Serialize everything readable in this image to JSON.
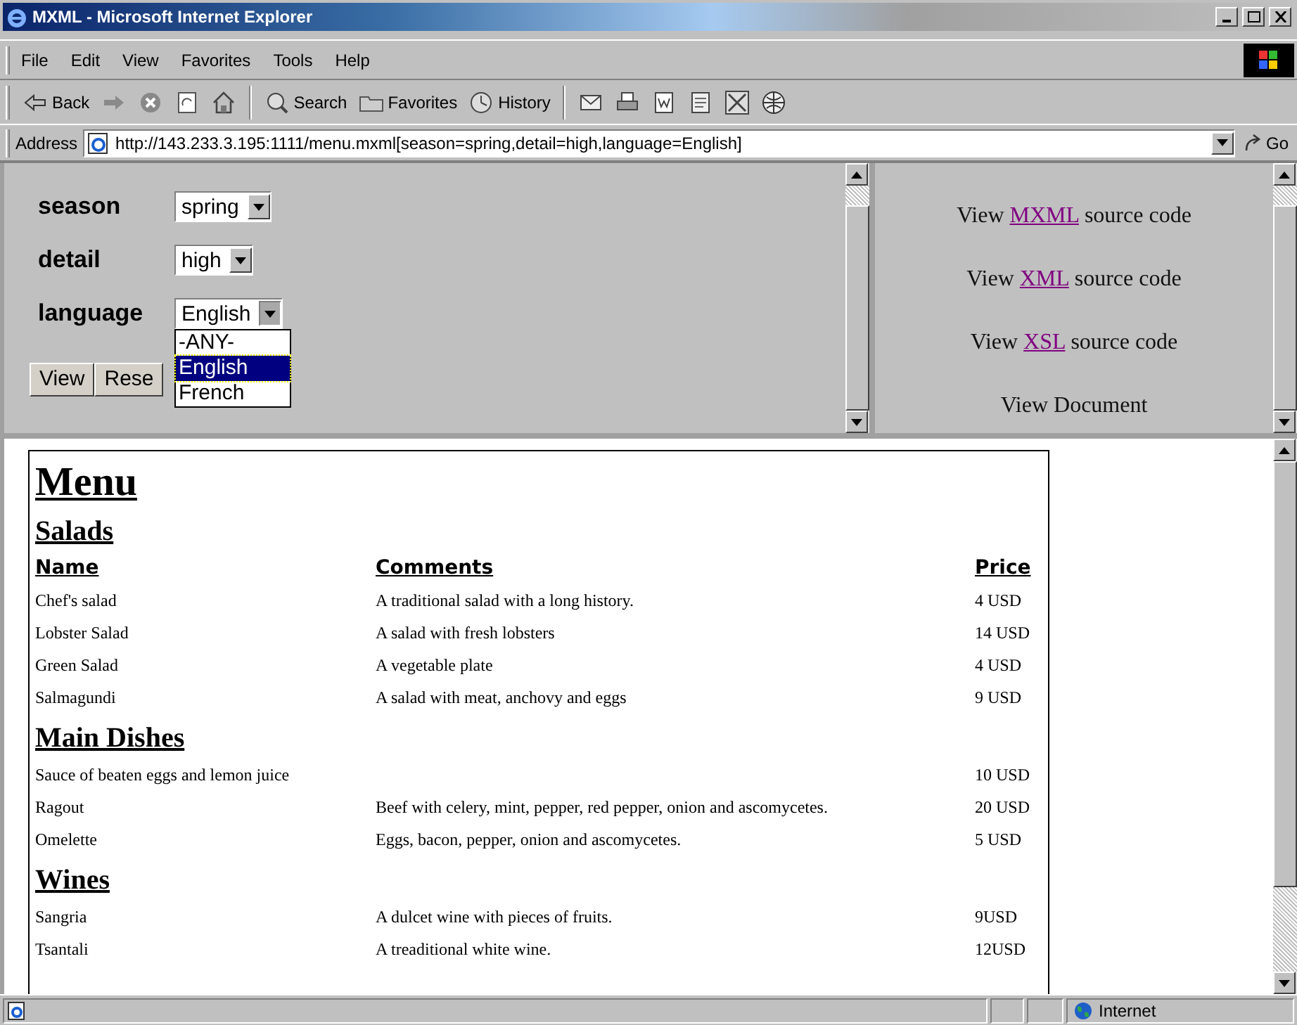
{
  "window": {
    "title": "MXML - Microsoft Internet Explorer"
  },
  "menu": [
    "File",
    "Edit",
    "View",
    "Favorites",
    "Tools",
    "Help"
  ],
  "toolbar": [
    {
      "kind": "back",
      "label": "Back"
    },
    {
      "kind": "forward"
    },
    {
      "kind": "stop"
    },
    {
      "kind": "refresh"
    },
    {
      "kind": "home"
    },
    {
      "kind": "sep"
    },
    {
      "kind": "search",
      "label": "Search"
    },
    {
      "kind": "favorites",
      "label": "Favorites"
    },
    {
      "kind": "history",
      "label": "History"
    },
    {
      "kind": "sep"
    },
    {
      "kind": "mail"
    },
    {
      "kind": "print"
    },
    {
      "kind": "edit"
    },
    {
      "kind": "discuss"
    },
    {
      "kind": "messenger"
    },
    {
      "kind": "globe"
    }
  ],
  "address": {
    "label": "Address",
    "value": "http://143.233.3.195:1111/menu.mxml[season=spring,detail=high,language=English]",
    "go": "Go"
  },
  "form": {
    "fields": [
      {
        "label": "season",
        "value": "spring"
      },
      {
        "label": "detail",
        "value": "high"
      },
      {
        "label": "language",
        "value": "English",
        "expanded": true,
        "options": [
          {
            "label": "-ANY-",
            "selected": false
          },
          {
            "label": "English",
            "selected": true
          },
          {
            "label": "French",
            "selected": false
          }
        ]
      }
    ],
    "buttons": [
      "View",
      "Rese"
    ]
  },
  "links": [
    {
      "before": "View",
      "link": "MXML",
      "after": "source code"
    },
    {
      "before": "View",
      "link": "XML",
      "after": "source code"
    },
    {
      "before": "View",
      "link": "XSL",
      "after": "source code"
    },
    {
      "before": "View Document"
    }
  ],
  "document": {
    "title": "Menu",
    "sections": [
      {
        "title": "Salads",
        "columns": [
          "Name",
          "Comments",
          "Price"
        ],
        "rows": [
          {
            "name": "Chef's salad",
            "comment": "A traditional salad with a long history.",
            "price": "4 USD"
          },
          {
            "name": "Lobster Salad",
            "comment": "A salad with fresh lobsters",
            "price": "14 USD"
          },
          {
            "name": "Green Salad",
            "comment": "A vegetable plate",
            "price": "4 USD"
          },
          {
            "name": "Salmagundi",
            "comment": "A salad with meat, anchovy and eggs",
            "price": "9 USD"
          }
        ]
      },
      {
        "title": "Main Dishes",
        "rows": [
          {
            "name": "Sauce of beaten eggs and lemon juice",
            "price": "10 USD"
          },
          {
            "name": "Ragout",
            "comment": "Beef with celery, mint, pepper, red pepper, onion and ascomycetes.",
            "price": "20 USD"
          },
          {
            "name": "Omelette",
            "comment": "Eggs, bacon, pepper, onion and ascomycetes.",
            "price": "5 USD"
          }
        ]
      },
      {
        "title": "Wines",
        "rows": [
          {
            "name": "Sangria",
            "comment": "A dulcet wine with pieces of fruits.",
            "price": "9USD"
          },
          {
            "name": "Tsantali",
            "comment": "A treaditional white wine.",
            "price": "12USD"
          }
        ]
      }
    ]
  },
  "status_bar": {
    "zone": "Internet"
  }
}
